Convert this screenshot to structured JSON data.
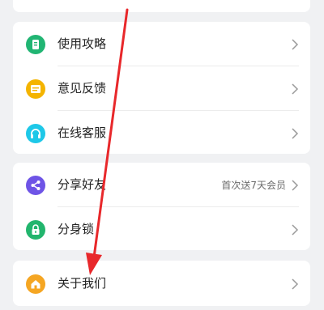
{
  "colors": {
    "guide": "#21b573",
    "feedback": "#f4b400",
    "service": "#1ec8e8",
    "share": "#6e54e6",
    "lock": "#22b56d",
    "about": "#f5a623",
    "arrow": "#e8282b"
  },
  "menu": {
    "group1": [
      {
        "label": "使用攻略",
        "icon": "guide-icon"
      },
      {
        "label": "意见反馈",
        "icon": "feedback-icon"
      },
      {
        "label": "在线客服",
        "icon": "headset-icon"
      }
    ],
    "group2": [
      {
        "label": "分享好友",
        "sub": "首次送7天会员",
        "icon": "share-icon"
      },
      {
        "label": "分身锁",
        "icon": "lock-icon"
      }
    ],
    "group3": [
      {
        "label": "关于我们",
        "icon": "home-icon"
      }
    ]
  }
}
